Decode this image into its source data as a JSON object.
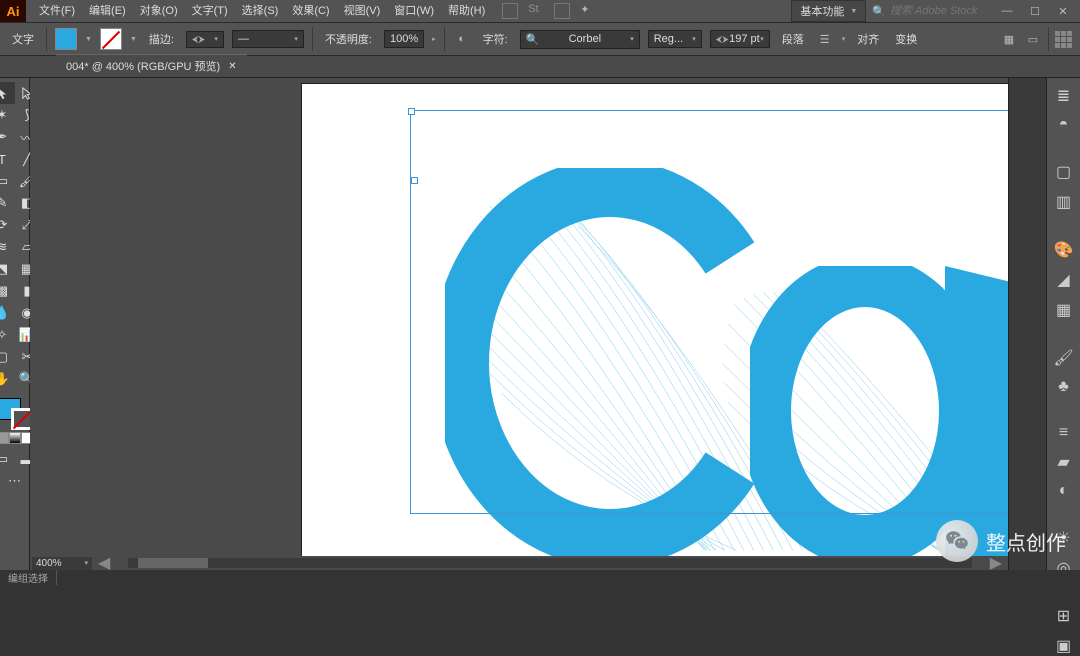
{
  "app": {
    "logo": "Ai"
  },
  "menubar": {
    "items": [
      "文件(F)",
      "编辑(E)",
      "对象(O)",
      "文字(T)",
      "选择(S)",
      "效果(C)",
      "视图(V)",
      "窗口(W)",
      "帮助(H)"
    ]
  },
  "top_right": {
    "workspace": "基本功能",
    "search_placeholder": "搜索 Adobe Stock"
  },
  "optbar": {
    "tool_label": "文字",
    "stroke_label": "描边:",
    "stroke_dash": "",
    "opacity_label": "不透明度:",
    "opacity_value": "100%",
    "char_label": "字符:",
    "font": "Corbel",
    "font_style": "Reg...",
    "font_size": "197 pt",
    "para_label": "段落",
    "align_label": "对齐",
    "transform_label": "变换"
  },
  "tab": {
    "label": "004* @ 400% (RGB/GPU 预览)"
  },
  "zoom": {
    "value": "400%"
  },
  "status": {
    "mode": "编组选择"
  },
  "right_icons": [
    "layers",
    "cc",
    "artboard",
    "lib",
    "color",
    "gradient",
    "swatch",
    "brush",
    "symbol",
    "stroke2",
    "char2",
    "para2",
    "appearance",
    "graphic",
    "transparency",
    "pathfinder",
    "align2",
    "transform2"
  ],
  "watermark": {
    "text": "整点创作"
  }
}
